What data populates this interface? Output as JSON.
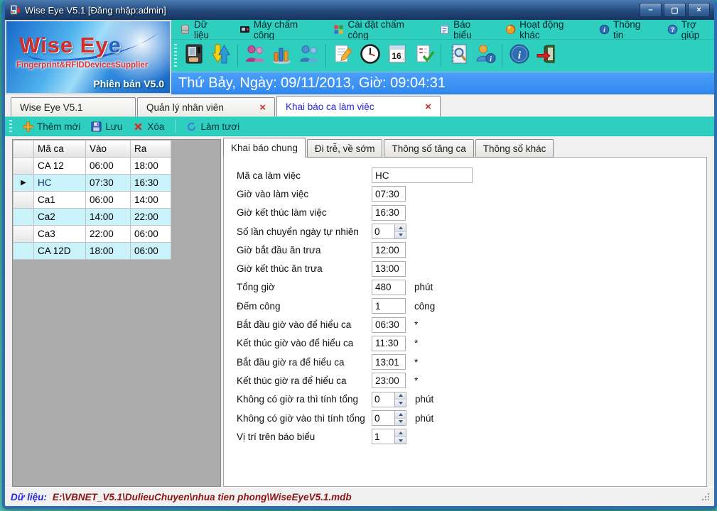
{
  "window": {
    "title": "Wise Eye V5.1 [Đăng nhập:admin]"
  },
  "logo": {
    "brand": "Wise Ey",
    "brand_accent": "e",
    "subtitle": "Fingerprint&RFIDDevicesSupplier",
    "version": "Phiên bản V5.0"
  },
  "header": {
    "datetime": "Thứ Bảy, Ngày: 09/11/2013, Giờ: 09:04:31"
  },
  "menu": {
    "items": [
      {
        "label": "Dữ liệu",
        "icon": "database-icon"
      },
      {
        "label": "Máy chấm công",
        "icon": "attendance-device-icon"
      },
      {
        "label": "Cài đặt chấm công",
        "icon": "settings-squares-icon"
      },
      {
        "label": "Báo biểu",
        "icon": "report-icon"
      },
      {
        "label": "Hoạt động khác",
        "icon": "activity-sphere-icon"
      },
      {
        "label": "Thông tin",
        "icon": "info-circle-icon"
      },
      {
        "label": "Trợ giúp",
        "icon": "help-circle-icon"
      }
    ]
  },
  "toolbar": {
    "buttons": [
      {
        "icon": "fingerprint-reader-icon"
      },
      {
        "icon": "sync-data-arrows-icon",
        "sep_after": true
      },
      {
        "icon": "employees-icon"
      },
      {
        "icon": "statistics-chart-icon"
      },
      {
        "icon": "users-icon",
        "sep_after": true
      },
      {
        "icon": "edit-document-icon"
      },
      {
        "icon": "clock-icon"
      },
      {
        "icon": "calendar-icon",
        "label": "16"
      },
      {
        "icon": "checklist-icon",
        "sep_after": true
      },
      {
        "icon": "search-log-icon"
      },
      {
        "icon": "user-info-icon",
        "sep_after": true
      },
      {
        "icon": "info-icon"
      },
      {
        "icon": "exit-icon"
      }
    ]
  },
  "tabs": [
    {
      "label": "Wise Eye V5.1",
      "closable": false,
      "active": false
    },
    {
      "label": "Quản lý nhân viên",
      "closable": true,
      "active": false
    },
    {
      "label": "Khai báo ca làm việc",
      "closable": true,
      "active": true
    }
  ],
  "actions": {
    "add": "Thêm mới",
    "save": "Lưu",
    "delete": "Xóa",
    "refresh": "Làm tươi"
  },
  "shift_table": {
    "columns": [
      "Mã ca",
      "Vào",
      "Ra"
    ],
    "rows": [
      [
        "CA 12",
        "06:00",
        "18:00"
      ],
      [
        "HC",
        "07:30",
        "16:30"
      ],
      [
        "Ca1",
        "06:00",
        "14:00"
      ],
      [
        "Ca2",
        "14:00",
        "22:00"
      ],
      [
        "Ca3",
        "22:00",
        "06:00"
      ],
      [
        "CA 12D",
        "18:00",
        "06:00"
      ]
    ],
    "selected_index": 1
  },
  "detail_tabs": {
    "active_index": 0,
    "items": [
      "Khai báo chung",
      "Đi trễ, về sớm",
      "Thông số tăng ca",
      "Thông số khác"
    ]
  },
  "form": {
    "fields": [
      {
        "label": "Mã ca làm việc",
        "value": "HC",
        "type": "text",
        "wide": true
      },
      {
        "label": "Giờ vào làm việc",
        "value": "07:30",
        "type": "text"
      },
      {
        "label": "Giờ kết thúc làm việc",
        "value": "16:30",
        "type": "text"
      },
      {
        "label": "Số lần chuyển ngày tự nhiên",
        "value": "0",
        "type": "spin"
      },
      {
        "label": "Giờ bắt đầu ăn trưa",
        "value": "12:00",
        "type": "text"
      },
      {
        "label": "Giờ kết thúc ăn trưa",
        "value": "13:00",
        "type": "text"
      },
      {
        "label": "Tổng giờ",
        "value": "480",
        "type": "text",
        "suffix": "phút"
      },
      {
        "label": "Đếm công",
        "value": "1",
        "type": "text",
        "suffix": "công"
      },
      {
        "label": "Bắt đầu giờ vào để hiểu ca",
        "value": "06:30",
        "type": "text",
        "suffix": "*"
      },
      {
        "label": "Kết thúc giờ vào để hiểu ca",
        "value": "11:30",
        "type": "text",
        "suffix": "*"
      },
      {
        "label": "Bắt đầu giờ ra để hiểu ca",
        "value": "13:01",
        "type": "text",
        "suffix": "*"
      },
      {
        "label": "Kết thúc giờ ra để hiểu ca",
        "value": "23:00",
        "type": "text",
        "suffix": "*"
      },
      {
        "label": "Không có giờ ra thì tính tổng",
        "value": "0",
        "type": "spin",
        "suffix": "phút"
      },
      {
        "label": "Không có giờ vào thì tính tổng",
        "value": "0",
        "type": "spin",
        "suffix": "phút"
      },
      {
        "label": "Vị trí trên báo biểu",
        "value": "1",
        "type": "spin"
      }
    ]
  },
  "window_controls": {
    "minimize": "–",
    "maximize": "❐",
    "close": "✕"
  },
  "status_bar": {
    "label": "Dữ liệu:",
    "path": "E:\\VBNET_V5.1\\DulieuChuyen\\nhua tien phong\\WiseEyeV5.1.mdb"
  },
  "colors": {
    "teal_bar": "#2FCFC0",
    "date_banner_blue": "#3188EE",
    "selected_cell_blue": "#3D9BF0",
    "row_alt_cyan": "#C9F2FA",
    "active_tab_text": "#2626D9",
    "status_path_red": "#8A1414"
  }
}
